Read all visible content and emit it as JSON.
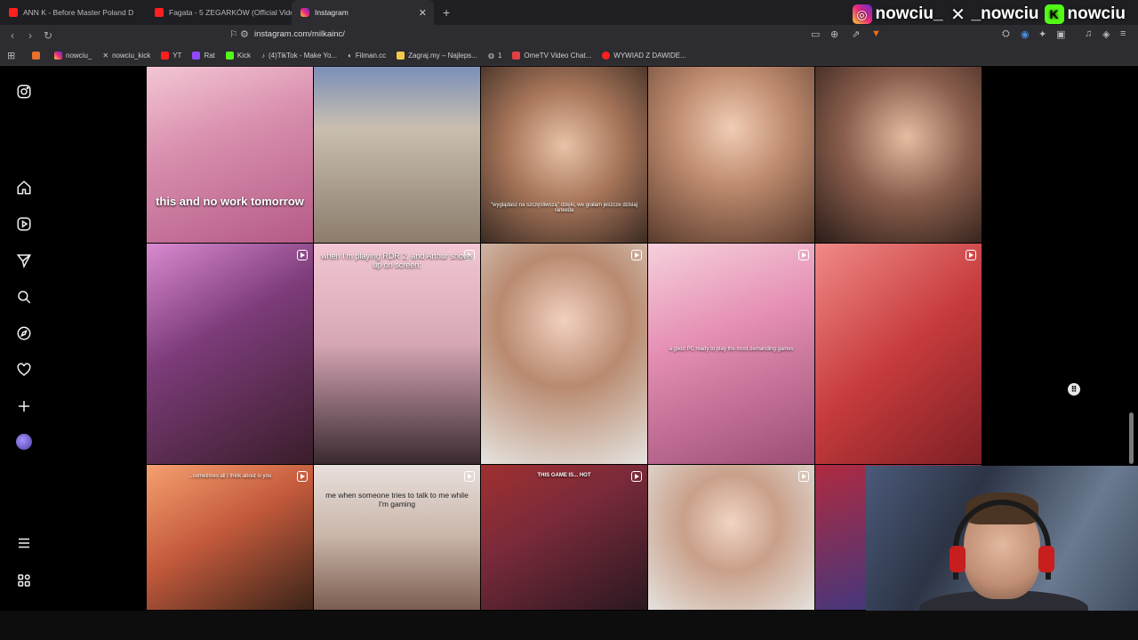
{
  "tabs": [
    {
      "label": "ANN K - Before Master Poland D",
      "favicon": "youtube-icon"
    },
    {
      "label": "Fagata - 5 ZEGARKÓW (Official Vide",
      "favicon": "youtube-icon"
    },
    {
      "label": "Instagram",
      "favicon": "instagram-icon"
    }
  ],
  "address": {
    "url": "instagram.com/milkainc/"
  },
  "bookmarks": [
    {
      "label": "",
      "icon": "folder-icon",
      "color": "#e8702a"
    },
    {
      "label": "nowciu_",
      "icon": "instagram-icon",
      "color": "#ee2a7b"
    },
    {
      "label": "nowciu_kick",
      "icon": "x-icon",
      "color": "#ffffff"
    },
    {
      "label": "YT",
      "icon": "youtube-icon",
      "color": "#ff1f1f"
    },
    {
      "label": "Rat",
      "icon": "twitch-icon",
      "color": "#9146ff"
    },
    {
      "label": "Kick",
      "icon": "kick-icon",
      "color": "#53fc18"
    },
    {
      "label": "(4)TikTok - Make Yo...",
      "icon": "tiktok-icon",
      "color": "#ffffff"
    },
    {
      "label": "Filman.cc",
      "icon": "film-icon",
      "color": "#cccccc"
    },
    {
      "label": "Zagraj.my – Najleps...",
      "icon": "game-icon",
      "color": "#f2c94c"
    },
    {
      "label": "1",
      "icon": "globe-icon",
      "color": "#cccccc"
    },
    {
      "label": "OmeTV Video Chat...",
      "icon": "video-icon",
      "color": "#e04040"
    },
    {
      "label": "WYWIAD Z DAWIDE...",
      "icon": "youtube-icon",
      "color": "#ff1f1f"
    }
  ],
  "socials": [
    {
      "handle": "nowciu_",
      "icon": "instagram-icon"
    },
    {
      "handle": "_nowciu",
      "icon": "x-icon"
    },
    {
      "handle": "nowciu",
      "icon": "kick-icon"
    }
  ],
  "posts": [
    {
      "caption": "this and no work tomorrow",
      "reel": false
    },
    {
      "caption": "",
      "reel": false
    },
    {
      "caption": "\"wyglądasz na szczęśliwszą\" dzięki, we grałam jeszcze dzisiaj rankeda",
      "reel": false
    },
    {
      "caption": "",
      "reel": false
    },
    {
      "caption": "",
      "reel": false
    },
    {
      "caption": "",
      "reel": true
    },
    {
      "caption": "when I'm playing RDR 2, and Arthur shows up on screen:",
      "reel": true
    },
    {
      "caption": "",
      "reel": true
    },
    {
      "caption": "a good PC ready to play the most demanding games",
      "reel": true
    },
    {
      "caption": "",
      "reel": true
    },
    {
      "caption": "...sometimes all I think about is you",
      "reel": true
    },
    {
      "caption": "me when someone tries to talk to me while I'm gaming",
      "reel": true
    },
    {
      "caption": "THIS GAME IS... HOT",
      "reel": true
    },
    {
      "caption": "",
      "reel": true
    },
    {
      "caption": "",
      "reel": false
    }
  ]
}
